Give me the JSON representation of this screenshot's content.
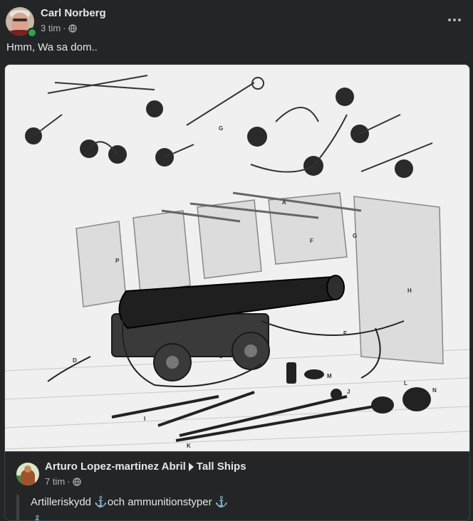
{
  "post": {
    "author": "Carl Norberg",
    "time": "3 tim",
    "separator": "·",
    "privacy_icon": "globe-icon",
    "more_icon": "more-dots-icon",
    "text": "Hmm, Wa sa dom.."
  },
  "shared": {
    "author": "Arturo Lopez-martinez Abril",
    "group": "Tall Ships",
    "time": "7 tim",
    "separator": "·",
    "privacy_icon": "globe-icon",
    "text": "Artilleriskydd ⚓och ammunitionstyper ⚓",
    "next_line_anchor": "⚓"
  },
  "image": {
    "subject": "cannon-on-gun-deck-illustration",
    "labels": [
      "G",
      "A",
      "D",
      "P",
      "F",
      "B",
      "C",
      "E",
      "M",
      "J",
      "N",
      "K",
      "I",
      "L",
      "H"
    ]
  },
  "colors": {
    "background": "#242526",
    "text_primary": "#e4e6eb",
    "text_secondary": "#b0b3b8",
    "online": "#31a24c"
  }
}
